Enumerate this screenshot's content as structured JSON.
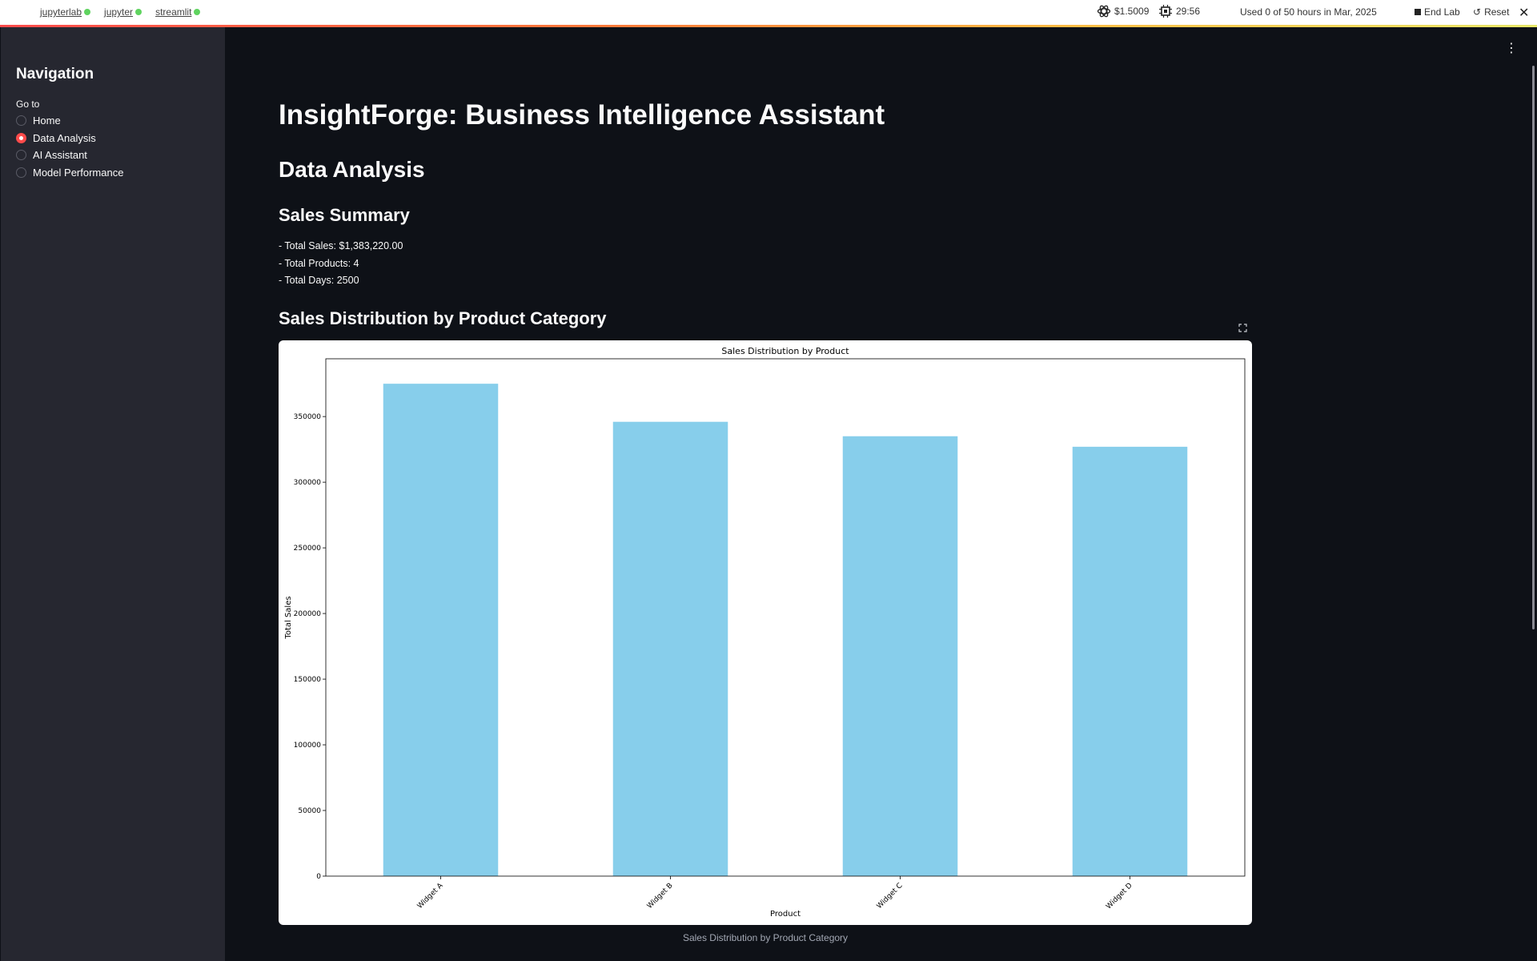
{
  "topbar": {
    "links": [
      {
        "label": "jupyterlab"
      },
      {
        "label": "jupyter"
      },
      {
        "label": "streamlit"
      }
    ],
    "cost": "$1.5009",
    "timer": "29:56",
    "usage": "Used 0 of 50 hours in Mar, 2025",
    "end_lab": "End Lab",
    "reset": "Reset"
  },
  "sidebar": {
    "title": "Navigation",
    "goto_label": "Go to",
    "options": [
      {
        "label": "Home",
        "selected": false
      },
      {
        "label": "Data Analysis",
        "selected": true
      },
      {
        "label": "AI Assistant",
        "selected": false
      },
      {
        "label": "Model Performance",
        "selected": false
      }
    ]
  },
  "main": {
    "title": "InsightForge: Business Intelligence Assistant",
    "section_title": "Data Analysis",
    "summary_title": "Sales Summary",
    "summary_lines": [
      "- Total Sales: $1,383,220.00",
      "- Total Products: 4",
      "- Total Days: 2500"
    ],
    "chart_section_title": "Sales Distribution by Product Category",
    "caption": "Sales Distribution by Product Category"
  },
  "colors": {
    "accent": "#ff4b4b",
    "bar": "#87ceeb",
    "background": "#0e1117",
    "sidebar": "#262730"
  },
  "chart_data": {
    "type": "bar",
    "title": "Sales Distribution by Product",
    "xlabel": "Product",
    "ylabel": "Total Sales",
    "categories": [
      "Widget A",
      "Widget B",
      "Widget C",
      "Widget D"
    ],
    "values": [
      375000,
      346000,
      335000,
      327000
    ],
    "ylim": [
      0,
      394000
    ],
    "yticks": [
      0,
      50000,
      100000,
      150000,
      200000,
      250000,
      300000,
      350000
    ],
    "grid": false,
    "legend": "none"
  }
}
